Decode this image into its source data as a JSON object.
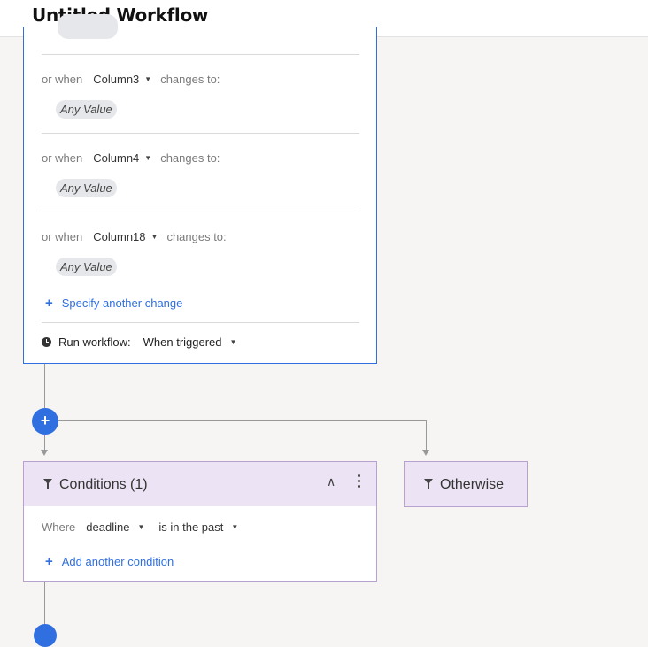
{
  "header": {
    "title": "Untitled Workflow"
  },
  "trigger": {
    "conditions": [
      {
        "prefix": "or when",
        "column": "Column3",
        "suffix": "changes to:",
        "value": "Any Value"
      },
      {
        "prefix": "or when",
        "column": "Column4",
        "suffix": "changes to:",
        "value": "Any Value"
      },
      {
        "prefix": "or when",
        "column": "Column18",
        "suffix": "changes to:",
        "value": "Any Value"
      }
    ],
    "add_change_label": "Specify another change",
    "run_label": "Run workflow:",
    "run_value": "When triggered"
  },
  "add_step": {
    "symbol": "+"
  },
  "conditions_block": {
    "title": "Conditions (1)",
    "where_label": "Where",
    "field": "deadline",
    "operator": "is in the past",
    "add_condition_label": "Add another condition"
  },
  "otherwise": {
    "label": "Otherwise"
  },
  "icons": [
    "clock-icon",
    "filter-icon",
    "chevron-up-icon",
    "more-vertical-icon",
    "plus-icon",
    "caret-down-icon"
  ],
  "colors": {
    "accent": "#2f6fe0",
    "condition_bg": "#ece4f4",
    "condition_border": "#b8a1cf",
    "canvas": "#f6f5f4"
  }
}
